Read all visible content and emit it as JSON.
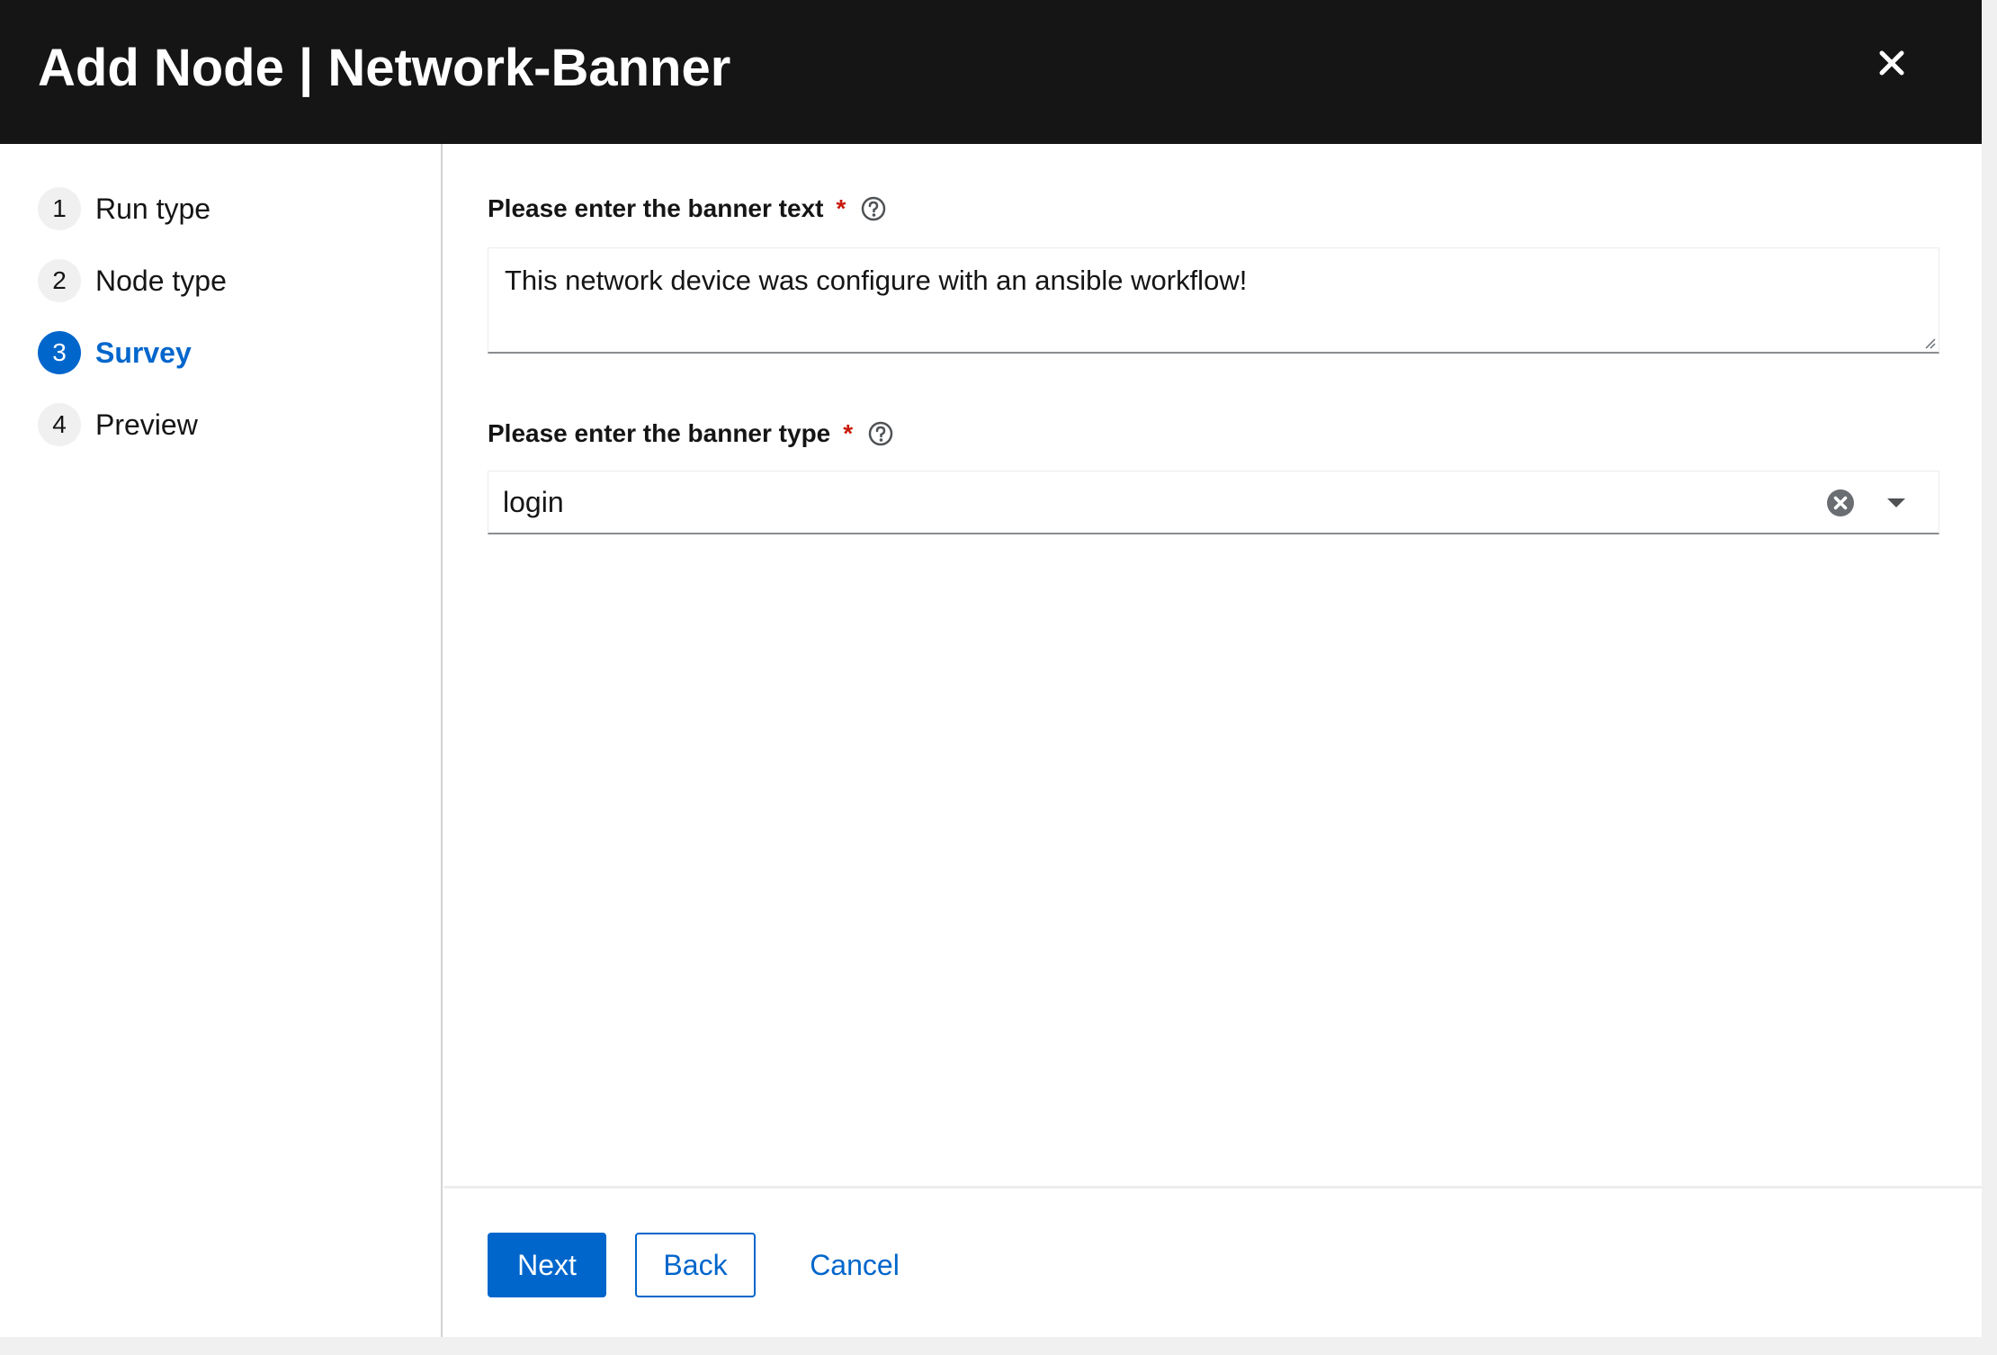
{
  "header": {
    "title": "Add Node | Network-Banner"
  },
  "wizard_nav": {
    "items": [
      {
        "number": "1",
        "label": "Run type"
      },
      {
        "number": "2",
        "label": "Node type"
      },
      {
        "number": "3",
        "label": "Survey",
        "active": true
      },
      {
        "number": "4",
        "label": "Preview"
      }
    ]
  },
  "form": {
    "banner_text": {
      "label": "Please enter the banner text",
      "required_marker": "*",
      "value": "This network device was configure with an ansible workflow!"
    },
    "banner_type": {
      "label": "Please enter the banner type",
      "required_marker": "*",
      "value": "login"
    }
  },
  "footer": {
    "next_label": "Next",
    "back_label": "Back",
    "cancel_label": "Cancel"
  },
  "colors": {
    "header_bg": "#151515",
    "primary": "#0066cc",
    "required": "#c9190b",
    "text": "#151515"
  }
}
